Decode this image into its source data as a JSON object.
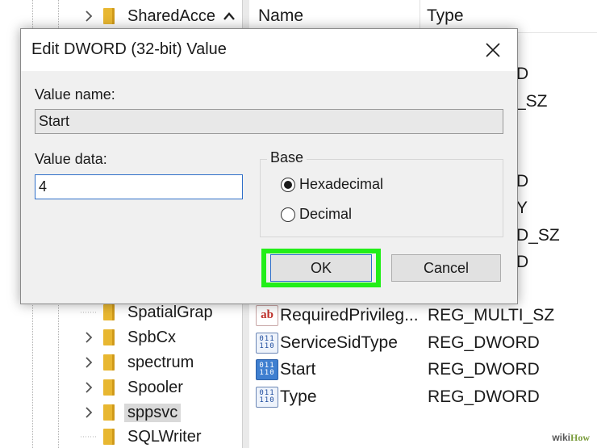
{
  "tree": {
    "items": [
      {
        "label": "SharedAcce",
        "has_children": true
      },
      {
        "label": "SpatialGrap",
        "has_children": false
      },
      {
        "label": "SpbCx",
        "has_children": true
      },
      {
        "label": "spectrum",
        "has_children": true
      },
      {
        "label": "Spooler",
        "has_children": true
      },
      {
        "label": "sppsvc",
        "has_children": true,
        "selected": true
      },
      {
        "label": "SQLWriter",
        "has_children": false
      }
    ]
  },
  "list": {
    "columns": {
      "name": "Name",
      "type": "Type"
    },
    "peek_types": [
      "D",
      "_SZ",
      "D",
      "Y",
      "D_SZ",
      "D"
    ],
    "rows": [
      {
        "icon": "string-value-icon",
        "name": "RequiredPrivileg...",
        "type": "REG_MULTI_SZ"
      },
      {
        "icon": "binary-value-icon",
        "name": "ServiceSidType",
        "type": "REG_DWORD"
      },
      {
        "icon": "binary-value-icon",
        "name": "Start",
        "type": "REG_DWORD",
        "selected": true
      },
      {
        "icon": "binary-value-icon",
        "name": "Type",
        "type": "REG_DWORD"
      }
    ]
  },
  "dialog": {
    "title": "Edit DWORD (32-bit) Value",
    "value_name_label": "Value name:",
    "value_name": "Start",
    "value_data_label": "Value data:",
    "value_data": "4",
    "base_label": "Base",
    "radio_hex": "Hexadecimal",
    "radio_dec": "Decimal",
    "selected_base": "Hexadecimal",
    "ok_label": "OK",
    "cancel_label": "Cancel",
    "highlight_color": "#22ee18"
  },
  "icons": {
    "binary_glyph": "011\n110",
    "string_glyph": "ab"
  },
  "watermark": {
    "part1": "wiki",
    "part2": "How"
  }
}
